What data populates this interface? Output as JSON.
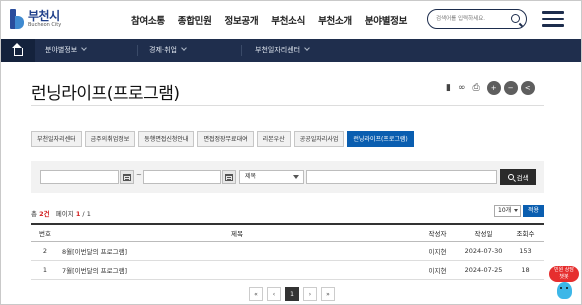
{
  "header": {
    "logo_ko": "부천시",
    "logo_en": "Bucheon City",
    "nav": [
      "참여소통",
      "종합민원",
      "정보공개",
      "부천소식",
      "부천소개",
      "분야별정보"
    ],
    "search_placeholder": "검색어를 입력하세요."
  },
  "breadcrumb": {
    "items": [
      "분야별정보",
      "경제·취업",
      "부천일자리센터"
    ]
  },
  "page": {
    "title": "런닝라이프(프로그램)"
  },
  "tabs": {
    "items": [
      "부천일자리센터",
      "금주의취업정보",
      "동행면접신청안내",
      "면접정장무료대여",
      "리본우산",
      "공공일자리사업",
      "런닝라이프(프로그램)"
    ],
    "active_index": 6
  },
  "filter": {
    "date_from": "",
    "date_to": "",
    "dash": "~",
    "field_select": "제목",
    "keyword": "",
    "search_button": "검색"
  },
  "summary": {
    "total_label": "총",
    "total_count": "2건",
    "page_label": "페이지",
    "page_current": "1",
    "page_sep": "/",
    "page_total": "1",
    "per_page": "10개",
    "apply": "적용"
  },
  "table": {
    "headers": [
      "번호",
      "제목",
      "작성자",
      "작성일",
      "조회수"
    ],
    "rows": [
      {
        "no": "2",
        "title": "8월[이번달의 프로그램]",
        "author": "이지현",
        "date": "2024-07-30",
        "views": "153"
      },
      {
        "no": "1",
        "title": "7월[이번달의 프로그램]",
        "author": "이지현",
        "date": "2024-07-25",
        "views": "18"
      }
    ]
  },
  "pager": {
    "first": "«",
    "prev": "‹",
    "current": "1",
    "next": "›",
    "last": "»"
  },
  "chatbot": {
    "line1": "민원 상담",
    "line2": "챗봇"
  },
  "colors": {
    "navy": "#1f2e4d",
    "accent_blue": "#0a5eb0",
    "highlight_red": "#d21f1f"
  }
}
